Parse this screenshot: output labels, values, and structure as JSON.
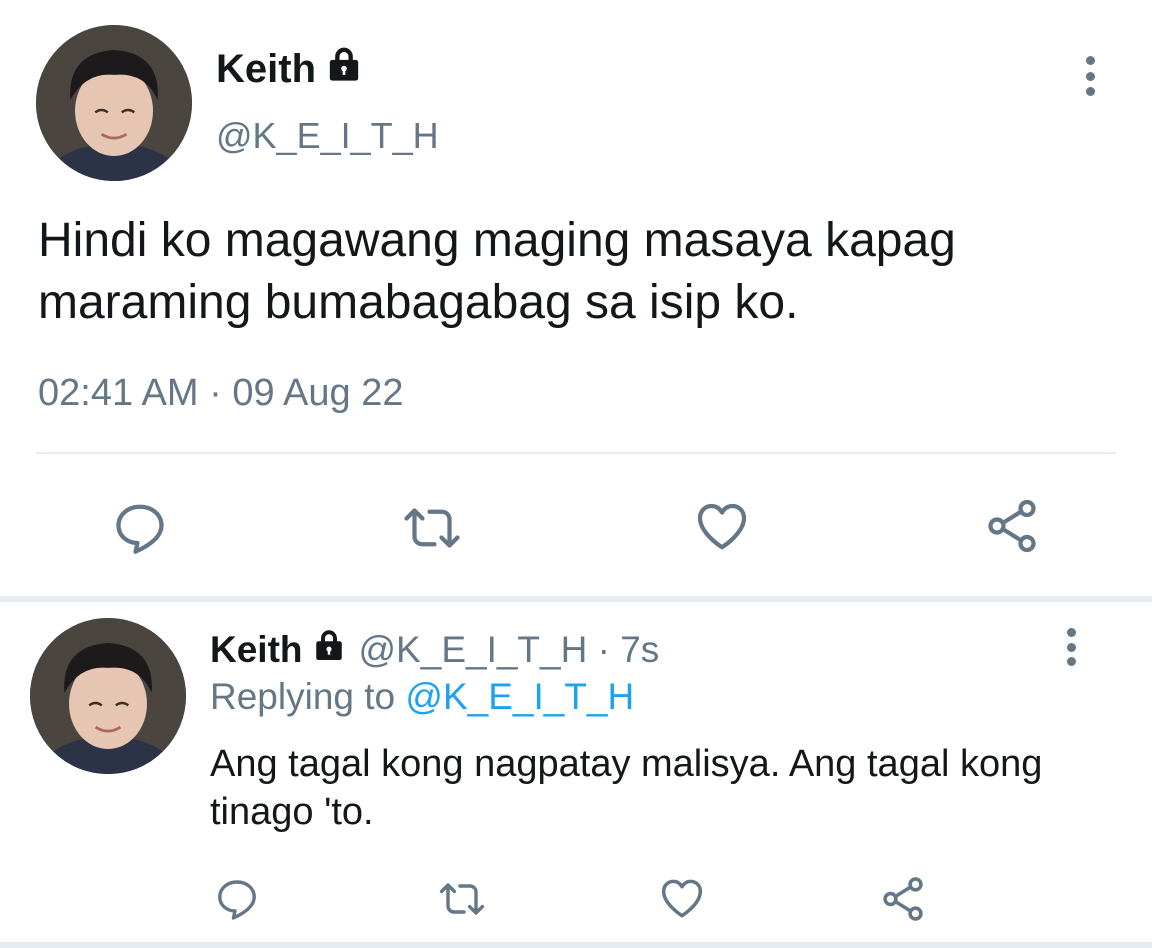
{
  "main_tweet": {
    "author_name": "Keith",
    "author_handle": "@K_E_I_T_H",
    "text": "Hindi ko magawang maging masaya kapag maraming bumabagabag sa isip ko.",
    "timestamp": "02:41 AM · 09 Aug 22",
    "icons": {
      "lock": "lock-icon",
      "more": "more-vertical-icon",
      "reply": "reply-icon",
      "retweet": "retweet-icon",
      "like": "heart-icon",
      "share": "share-icon"
    }
  },
  "reply_tweet": {
    "author_name": "Keith",
    "author_handle_time": "@K_E_I_T_H · 7s",
    "replying_prefix": "Replying to",
    "replying_to": "@K_E_I_T_H",
    "text": "Ang tagal kong nagpatay malisya. Ang tagal kong tinago 'to."
  },
  "colors": {
    "text_primary": "#14171a",
    "text_secondary": "#657786",
    "link": "#1da1f2",
    "divider": "#e6ecf0"
  }
}
